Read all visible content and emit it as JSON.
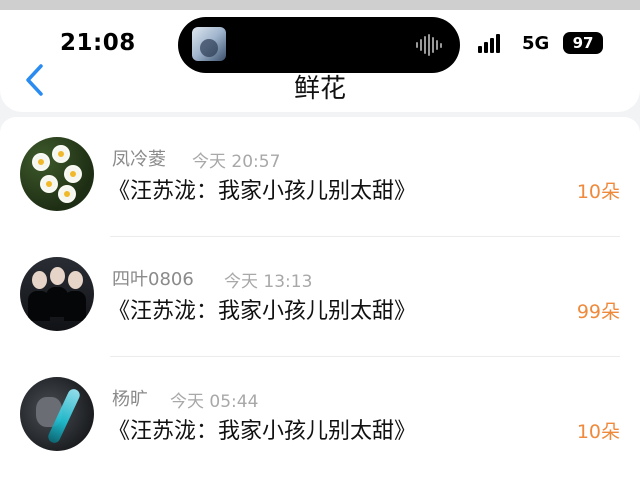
{
  "status_bar": {
    "time": "21:08",
    "network": "5G",
    "battery": "97",
    "now_playing_icon": "album-art-thumbnail",
    "audio_icon": "waveform-icon",
    "signal_icon": "signal-bars-icon"
  },
  "header": {
    "back_icon": "chevron-left-icon",
    "title": "鲜花"
  },
  "accent_colors": {
    "back": "#2a8cf0",
    "amount": "#ef8a3c"
  },
  "gifts": [
    {
      "name": "凤冷菱",
      "time": "今天 20:57",
      "title": "《汪苏泷：我家小孩儿别太甜》",
      "amount": "10朵",
      "avatar_icon": "narcissus-flowers-avatar"
    },
    {
      "name": "四叶0806",
      "time": "今天 13:13",
      "title": "《汪苏泷：我家小孩儿别太甜》",
      "amount": "99朵",
      "avatar_icon": "group-photo-avatar"
    },
    {
      "name": "杨旷",
      "time": "今天 05:44",
      "title": "《汪苏泷：我家小孩儿别太甜》",
      "amount": "10朵",
      "avatar_icon": "game-character-avatar"
    }
  ]
}
